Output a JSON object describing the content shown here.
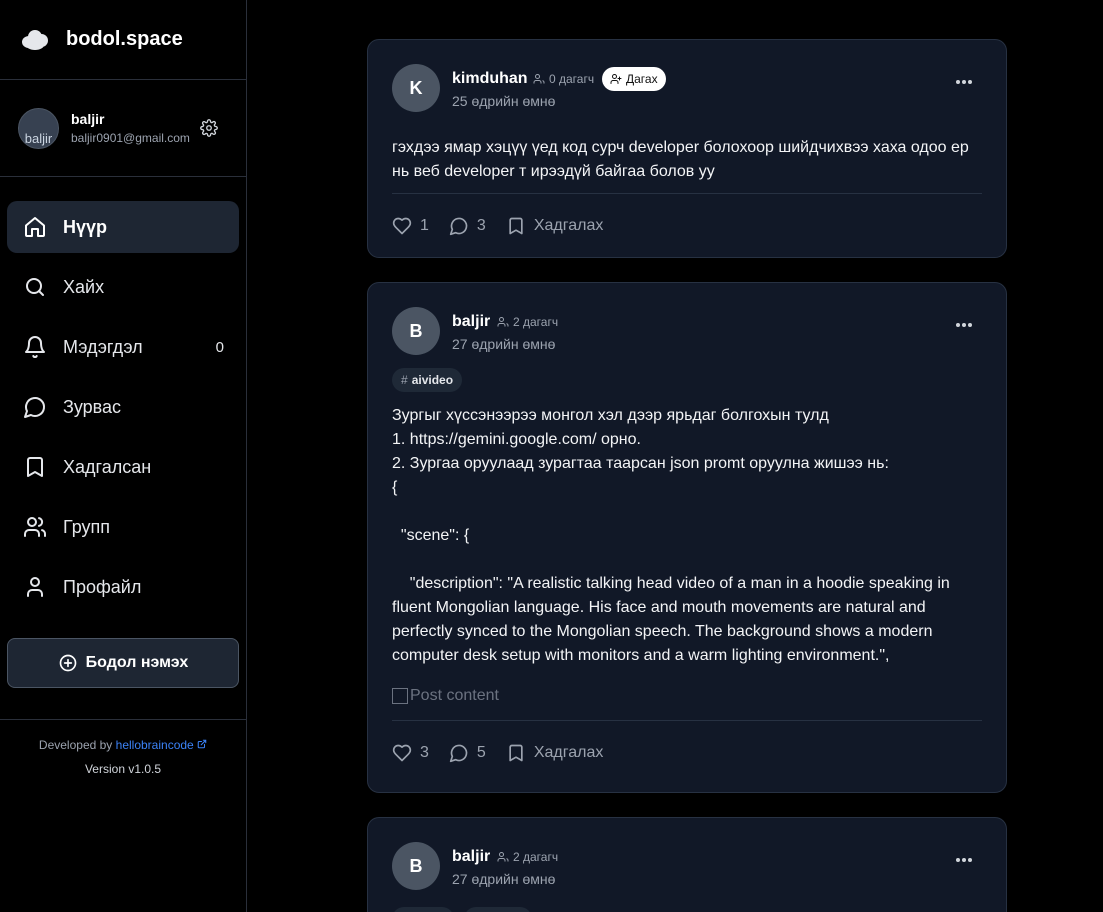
{
  "brand": {
    "name": "bodol.space",
    "logo_icon": "cloud-icon"
  },
  "user": {
    "name": "baljir",
    "email": "baljir0901@gmail.com",
    "avatar_alt": "baljir"
  },
  "nav": {
    "items": [
      {
        "label": "Нүүр",
        "icon": "home-icon",
        "active": true
      },
      {
        "label": "Хайх",
        "icon": "search-icon"
      },
      {
        "label": "Мэдэгдэл",
        "icon": "bell-icon",
        "count": "0"
      },
      {
        "label": "Зурвас",
        "icon": "message-icon"
      },
      {
        "label": "Хадгалсан",
        "icon": "bookmark-icon"
      },
      {
        "label": "Групп",
        "icon": "users-icon"
      },
      {
        "label": "Профайл",
        "icon": "user-icon"
      }
    ],
    "add_button": "Бодол нэмэх"
  },
  "footer": {
    "developed_by": "Developed by",
    "developer": "hellobraincode",
    "version": "Version v1.0.5"
  },
  "posts": [
    {
      "avatar": "K",
      "author": "kimduhan",
      "followers": "0 дагагч",
      "follow_label": "Дагах",
      "time": "25 өдрийн өмнө",
      "text": "гэхдээ ямар  хэцүү үед код сурч developer болохоор шийдчихвээ хаха одоо ер нь веб developer т ирээдүй байгаа болов уу",
      "likes": "1",
      "comments": "3",
      "save_label": "Хадгалах"
    },
    {
      "avatar": "B",
      "author": "baljir",
      "followers": "2 дагагч",
      "time": "27 өдрийн өмнө",
      "tag": "aivideo",
      "lines": [
        "Зургыг хүссэнээрээ монгол хэл дээр ярьдаг болгохын тулд",
        "1. https://gemini.google.com/ орно.",
        "2. Зургаа оруулаад зурагтаа таарсан json promt оруулна жишээ нь:",
        "{",
        "",
        "  \"scene\": {",
        "",
        "    \"description\": \"A realistic talking head video of a man in a hoodie speaking in fluent Mongolian language. His face and mouth movements are natural and perfectly synced to the Mongolian speech. The background shows a modern computer desk setup with monitors and a warm lighting environment.\","
      ],
      "image_alt": "Post content",
      "likes": "3",
      "comments": "5",
      "save_label": "Хадгалах"
    },
    {
      "avatar": "B",
      "author": "baljir",
      "followers": "2 дагагч",
      "time": "27 өдрийн өмнө"
    }
  ]
}
